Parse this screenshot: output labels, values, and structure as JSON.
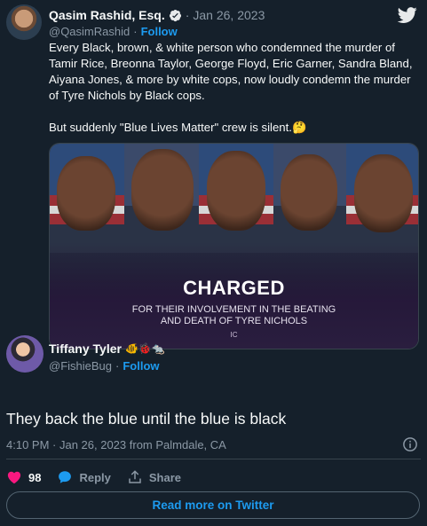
{
  "quoted_tweet": {
    "author_name": "Qasim Rashid, Esq.",
    "handle": "@QasimRashid",
    "separator": "·",
    "date": "Jan 26, 2023",
    "follow_label": "Follow",
    "text_paragraph_1": "Every Black, brown, & white person who condemned the murder of Tamir Rice, Breonna Taylor, George Floyd, Eric Garner, Sandra Bland, Aiyana Jones, & more by white cops, now loudly condemn the murder of Tyre Nichols by Black cops.",
    "text_paragraph_2": "But suddenly \"Blue Lives Matter\" crew is silent.🤔",
    "image": {
      "headline": "CHARGED",
      "subtext_line_1": "FOR THEIR INVOLVEMENT IN THE BEATING",
      "subtext_line_2": "AND DEATH OF TYRE NICHOLS",
      "mark": "IC"
    }
  },
  "reply_tweet": {
    "author_name": "Tiffany Tyler",
    "name_emojis": "🐠🐞🐀",
    "handle": "@FishieBug",
    "separator": "·",
    "follow_label": "Follow",
    "text": "They back the blue until the blue is black",
    "timestamp": "4:10 PM · Jan 26, 2023 from Palmdale, CA"
  },
  "actions": {
    "like_count": "98",
    "reply_label": "Reply",
    "share_label": "Share"
  },
  "read_more_label": "Read more on Twitter",
  "colors": {
    "background": "#15202b",
    "link_blue": "#1d9bf0",
    "muted": "#8b98a5",
    "like_pink": "#f91880"
  }
}
